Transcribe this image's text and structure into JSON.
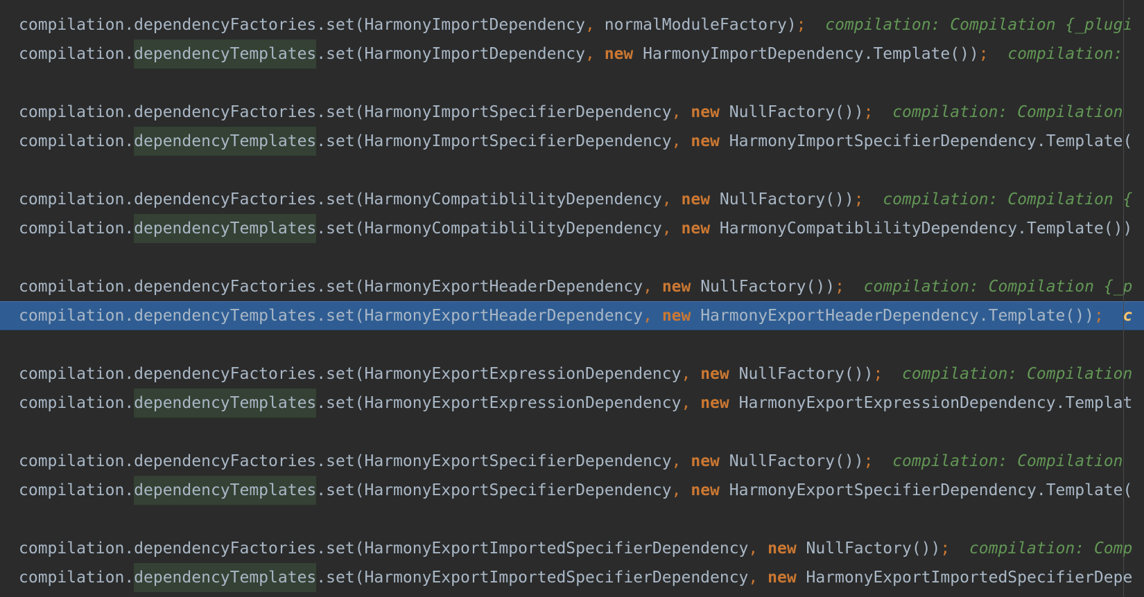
{
  "editor": {
    "keyword_new": "new",
    "lines": [
      {
        "obj": "compilation.",
        "prop": "dependencyFactories",
        "rest": ".set(HarmonyImportDependency",
        "sep": ",",
        "kw": "",
        "arg": " normalModuleFactory)",
        "semi": ";",
        "hint": "compilation: Compilation {_plugi",
        "highlight_prop": false,
        "selected": false
      },
      {
        "obj": "compilation.",
        "prop": "dependencyTemplates",
        "rest": ".set(HarmonyImportDependency",
        "sep": ",",
        "kw": "new",
        "arg": " HarmonyImportDependency.Template())",
        "semi": ";",
        "hint": "compilation:",
        "highlight_prop": true,
        "selected": false
      },
      {
        "blank": true
      },
      {
        "obj": "compilation.",
        "prop": "dependencyFactories",
        "rest": ".set(HarmonyImportSpecifierDependency",
        "sep": ",",
        "kw": "new",
        "arg": " NullFactory())",
        "semi": ";",
        "hint": "compilation: Compilation",
        "highlight_prop": false,
        "selected": false
      },
      {
        "obj": "compilation.",
        "prop": "dependencyTemplates",
        "rest": ".set(HarmonyImportSpecifierDependency",
        "sep": ",",
        "kw": "new",
        "arg": " HarmonyImportSpecifierDependency.Template(",
        "semi": "",
        "hint": "",
        "highlight_prop": true,
        "selected": false
      },
      {
        "blank": true
      },
      {
        "obj": "compilation.",
        "prop": "dependencyFactories",
        "rest": ".set(HarmonyCompatiblilityDependency",
        "sep": ",",
        "kw": "new",
        "arg": " NullFactory())",
        "semi": ";",
        "hint": "compilation: Compilation {",
        "highlight_prop": false,
        "selected": false
      },
      {
        "obj": "compilation.",
        "prop": "dependencyTemplates",
        "rest": ".set(HarmonyCompatiblilityDependency",
        "sep": ",",
        "kw": "new",
        "arg": " HarmonyCompatiblilityDependency.Template())",
        "semi": "",
        "hint": "",
        "highlight_prop": true,
        "selected": false
      },
      {
        "blank": true
      },
      {
        "obj": "compilation.",
        "prop": "dependencyFactories",
        "rest": ".set(HarmonyExportHeaderDependency",
        "sep": ",",
        "kw": "new",
        "arg": " NullFactory())",
        "semi": ";",
        "hint": "compilation: Compilation {_p",
        "highlight_prop": false,
        "selected": false
      },
      {
        "obj": "compilation.",
        "prop": "dependencyTemplates",
        "rest": ".set(HarmonyExportHeaderDependency",
        "sep": ",",
        "kw": "new",
        "arg": " HarmonyExportHeaderDependency.Template())",
        "semi": ";",
        "hint": "c",
        "highlight_prop": true,
        "selected": true
      },
      {
        "blank": true
      },
      {
        "obj": "compilation.",
        "prop": "dependencyFactories",
        "rest": ".set(HarmonyExportExpressionDependency",
        "sep": ",",
        "kw": "new",
        "arg": " NullFactory())",
        "semi": ";",
        "hint": "compilation: Compilation",
        "highlight_prop": false,
        "selected": false
      },
      {
        "obj": "compilation.",
        "prop": "dependencyTemplates",
        "rest": ".set(HarmonyExportExpressionDependency",
        "sep": ",",
        "kw": "new",
        "arg": " HarmonyExportExpressionDependency.Templat",
        "semi": "",
        "hint": "",
        "highlight_prop": true,
        "selected": false
      },
      {
        "blank": true
      },
      {
        "obj": "compilation.",
        "prop": "dependencyFactories",
        "rest": ".set(HarmonyExportSpecifierDependency",
        "sep": ",",
        "kw": "new",
        "arg": " NullFactory())",
        "semi": ";",
        "hint": "compilation: Compilation",
        "highlight_prop": false,
        "selected": false
      },
      {
        "obj": "compilation.",
        "prop": "dependencyTemplates",
        "rest": ".set(HarmonyExportSpecifierDependency",
        "sep": ",",
        "kw": "new",
        "arg": " HarmonyExportSpecifierDependency.Template(",
        "semi": "",
        "hint": "",
        "highlight_prop": true,
        "selected": false
      },
      {
        "blank": true
      },
      {
        "obj": "compilation.",
        "prop": "dependencyFactories",
        "rest": ".set(HarmonyExportImportedSpecifierDependency",
        "sep": ",",
        "kw": "new",
        "arg": " NullFactory())",
        "semi": ";",
        "hint": "compilation: Comp",
        "highlight_prop": false,
        "selected": false
      },
      {
        "obj": "compilation.",
        "prop": "dependencyTemplates",
        "rest": ".set(HarmonyExportImportedSpecifierDependency",
        "sep": ",",
        "kw": "new",
        "arg": " HarmonyExportImportedSpecifierDepe",
        "semi": "",
        "hint": "",
        "highlight_prop": true,
        "selected": false
      }
    ]
  },
  "colors": {
    "background": "#2b2b2b",
    "text": "#a9b7c6",
    "keyword": "#cc7832",
    "hint": "#629755",
    "selection": "#2f5d93",
    "identifier_highlight": "#344134"
  }
}
